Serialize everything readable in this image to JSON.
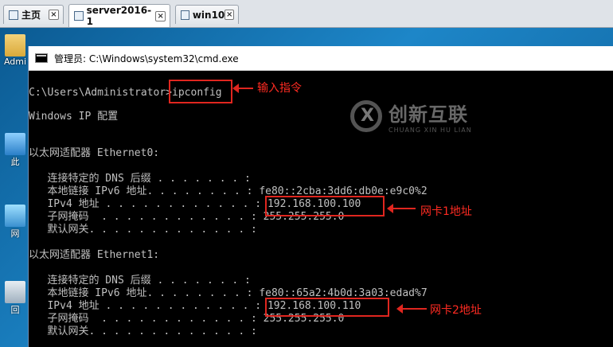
{
  "tabs": [
    {
      "label": "主页",
      "icon": "home-icon"
    },
    {
      "label": "server2016-1",
      "icon": "vm-icon",
      "active": true
    },
    {
      "label": "win10",
      "icon": "vm-icon"
    }
  ],
  "tab_close_glyph": "×",
  "desktop": {
    "icons": [
      {
        "label": "Admi",
        "icon": "folder-icon"
      },
      {
        "label": "此",
        "icon": "computer-icon"
      },
      {
        "label": "网",
        "icon": "network-icon"
      },
      {
        "label": "回",
        "icon": "recycle-bin-icon"
      }
    ]
  },
  "cmd": {
    "title": "管理员: C:\\Windows\\system32\\cmd.exe",
    "prompt": "C:\\Users\\Administrator>",
    "command": "ipconfig",
    "lines": {
      "header": "Windows IP 配置",
      "adapter0": "以太网适配器 Ethernet0:",
      "a0_dns": "   连接特定的 DNS 后缀 . . . . . . . :",
      "a0_v6": "   本地链接 IPv6 地址. . . . . . . . : fe80::2cba:3dd6:db0e:e9c0%2",
      "a0_v4_label": "   IPv4 地址 . . . . . . . . . . . . : ",
      "a0_v4": "192.168.100.100",
      "a0_mask": "   子网掩码  . . . . . . . . . . . . : 255.255.255.0",
      "a0_gw": "   默认网关. . . . . . . . . . . . . :",
      "adapter1": "以太网适配器 Ethernet1:",
      "a1_dns": "   连接特定的 DNS 后缀 . . . . . . . :",
      "a1_v6": "   本地链接 IPv6 地址. . . . . . . . : fe80::65a2:4b0d:3a03:edad%7",
      "a1_v4_label": "   IPv4 地址 . . . . . . . . . . . . : ",
      "a1_v4": "192.168.100.110",
      "a1_mask": "   子网掩码  . . . . . . . . . . . . : 255.255.255.0",
      "a1_gw": "   默认网关. . . . . . . . . . . . . :"
    }
  },
  "annotations": {
    "command_note": "输入指令",
    "nic1_note": "网卡1地址",
    "nic2_note": "网卡2地址",
    "color": "#e0261f"
  },
  "watermark": {
    "name": "创新互联",
    "pinyin": "CHUANG XIN HU LIAN"
  }
}
